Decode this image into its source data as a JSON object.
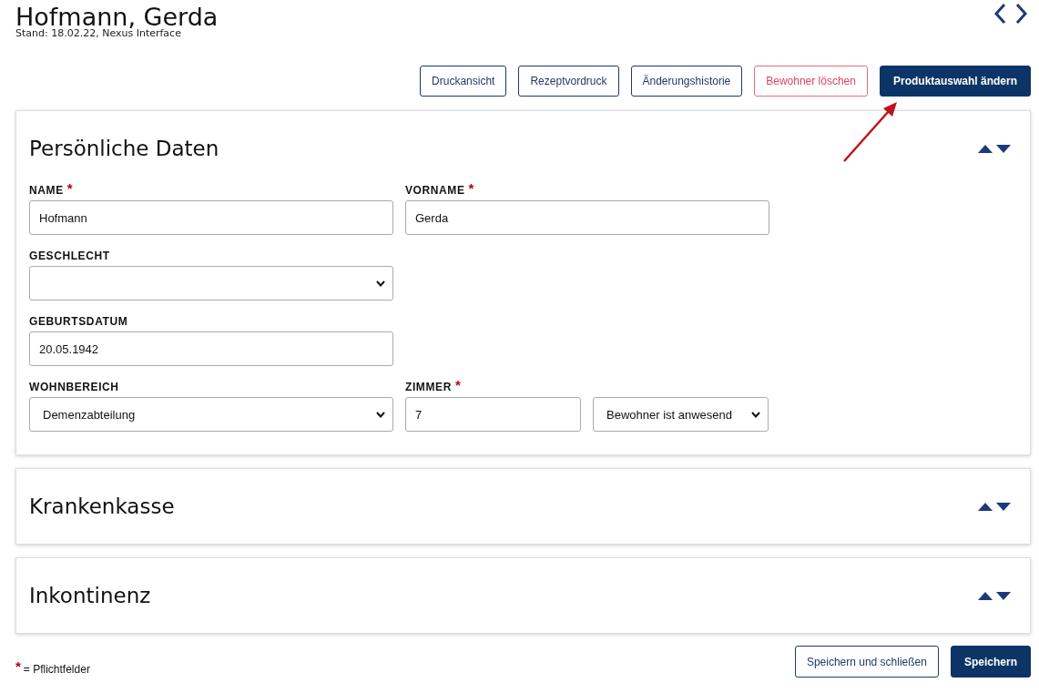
{
  "header": {
    "title": "Hofmann, Gerda",
    "subtitle": "Stand: 18.02.22, Nexus Interface"
  },
  "actions": [
    {
      "label": "Druckansicht",
      "kind": "outline"
    },
    {
      "label": "Rezeptvordruck",
      "kind": "outline"
    },
    {
      "label": "Änderungshistorie",
      "kind": "outline"
    },
    {
      "label": "Bewohner löschen",
      "kind": "danger"
    },
    {
      "label": "Produktauswahl ändern",
      "kind": "primary"
    }
  ],
  "sections": [
    {
      "title": "Persönliche Daten",
      "rows": [
        {
          "fields": [
            {
              "label": "NAME",
              "required_mark": "*",
              "kind": "text",
              "value": "Hofmann"
            },
            {
              "label": "VORNAME",
              "required_mark": "*",
              "kind": "text",
              "value": "Gerda"
            }
          ]
        },
        {
          "fields": [
            {
              "label": "GESCHLECHT",
              "kind": "select"
            }
          ]
        },
        {
          "fields": [
            {
              "label": "GEBURTSDATUM",
              "kind": "text",
              "value": "20.05.1942"
            }
          ]
        },
        {
          "fields": [
            {
              "label": "WOHNBEREICH",
              "kind": "select",
              "value": "Demenzabteilung"
            },
            {
              "label": "ZIMMER",
              "required_mark": "*",
              "kind": "text",
              "value": "7"
            },
            {
              "kind": "select",
              "value": "Bewohner ist anwesend"
            }
          ]
        }
      ]
    },
    {
      "title": "Krankenkasse"
    },
    {
      "title": "Inkontinenz"
    }
  ],
  "legend": {
    "mark": "*",
    "text": "= Pflichtfelder"
  },
  "footer_buttons": [
    {
      "label": "Speichern und schließen",
      "kind": "outline"
    },
    {
      "label": "Speichern",
      "kind": "primary"
    }
  ]
}
